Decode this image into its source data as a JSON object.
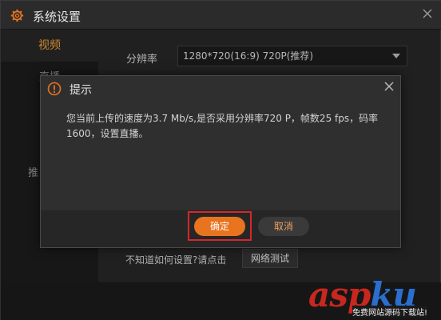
{
  "window": {
    "title": "系统设置",
    "title_icon": "gear-icon",
    "close_icon": "close-icon"
  },
  "sidebar": {
    "items": [
      {
        "label": "视频",
        "active": true
      },
      {
        "label": "直播"
      },
      {
        "label": ""
      },
      {
        "label": ""
      },
      {
        "label": "推"
      },
      {
        "label": ""
      }
    ]
  },
  "video_settings": {
    "resolution_label": "分辨率",
    "resolution_value": "1280*720(16:9) 720P(推荐)",
    "help_text": "不知道如何设置?请点击",
    "network_test_label": "网络测试"
  },
  "dialog": {
    "title": "提示",
    "icon": "warning-icon",
    "message": "您当前上传的速度为3.7 Mb/s,是否采用分辨率720 P，帧数25 fps，码率1600，设置直播。",
    "ok_label": "确定",
    "cancel_label": "取消"
  },
  "watermark": {
    "logo_text_red": "asp",
    "logo_text_blue": "ku",
    "logo_suffix": ".com",
    "subtitle": "免费网站源码下载站!"
  },
  "colors": {
    "accent": "#e8741f",
    "highlight_frame": "#d9262a",
    "background": "#262626"
  }
}
